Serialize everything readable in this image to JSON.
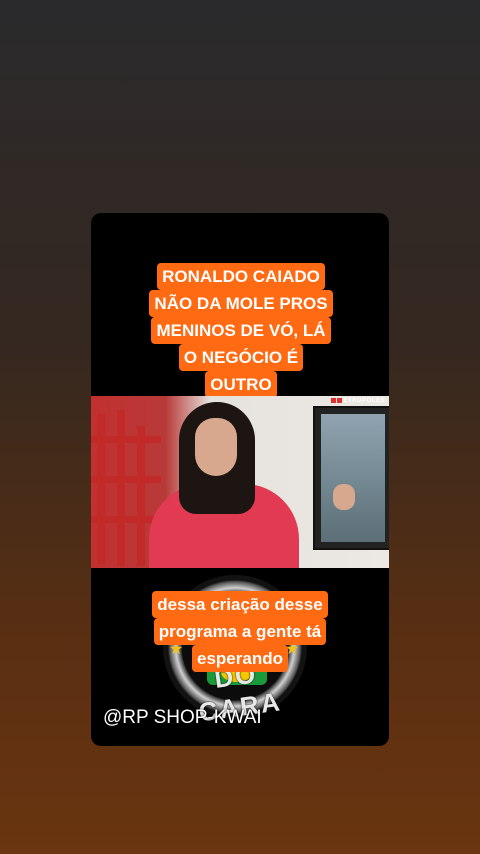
{
  "headline": {
    "lines": [
      "RONALDO CAIADO",
      "NÃO DA MOLE PROS",
      "MENINOS DE VÓ, LÁ",
      "O NEGÓCIO É",
      "OUTRO"
    ]
  },
  "video": {
    "watermark": "ETROPOLES"
  },
  "badge": {
    "text": "DO CARA"
  },
  "subtitle": {
    "lines": [
      "dessa criação desse",
      "programa a gente tá",
      "esperando"
    ]
  },
  "credit": "@RP SHOP-KWAI",
  "colors": {
    "accent": "#ff6a12",
    "card_bg": "#000000"
  }
}
